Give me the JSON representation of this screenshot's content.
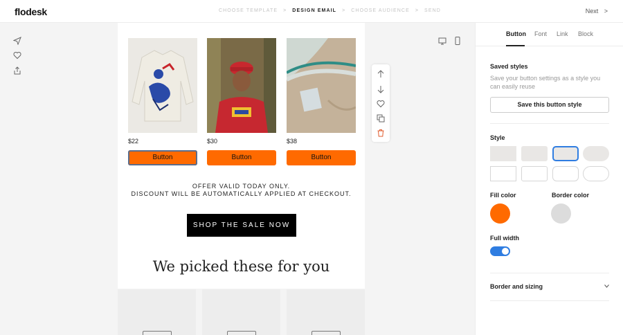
{
  "header": {
    "logo": "flodesk",
    "steps": [
      "CHOOSE TEMPLATE",
      "DESIGN EMAIL",
      "CHOOSE AUDIENCE",
      "SEND"
    ],
    "active_step": "DESIGN EMAIL",
    "step_separator": ">",
    "next_label": "Next",
    "next_arrow": ">"
  },
  "left_rail": {
    "icons": [
      "send-icon",
      "heart-icon",
      "share-icon"
    ]
  },
  "email": {
    "products": [
      {
        "price": "$22",
        "button": "Button",
        "image": "sweatshirt-photo"
      },
      {
        "price": "$30",
        "button": "Button",
        "image": "person-photo"
      },
      {
        "price": "$38",
        "button": "Button",
        "image": "fabric-photo"
      }
    ],
    "offer_line1": "OFFER VALID TODAY ONLY.",
    "offer_line2": "DISCOUNT WILL BE AUTOMATICALLY APPLIED AT CHECKOUT.",
    "cta": "SHOP THE SALE NOW",
    "section_heading": "We picked these for you"
  },
  "toolstrip": {
    "icons": [
      "arrow-up-icon",
      "arrow-down-icon",
      "heart-icon",
      "duplicate-icon",
      "trash-icon"
    ]
  },
  "view_toggle": {
    "icons": [
      "desktop-icon",
      "mobile-icon"
    ]
  },
  "panel": {
    "tabs": [
      "Button",
      "Font",
      "Link",
      "Block"
    ],
    "active_tab": "Button",
    "saved_styles_title": "Saved styles",
    "saved_styles_desc": "Save your button settings as a style you can easily reuse",
    "save_button": "Save this button style",
    "style_title": "Style",
    "fill_color_label": "Fill color",
    "border_color_label": "Border color",
    "fill_color": "#ff6a00",
    "border_color": "#dcdcdc",
    "full_width_label": "Full width",
    "full_width_on": true,
    "border_sizing_label": "Border and sizing"
  },
  "colors": {
    "accent": "#ff6a00",
    "toggle": "#2f7de1",
    "selected_style": "#2f7de1"
  }
}
